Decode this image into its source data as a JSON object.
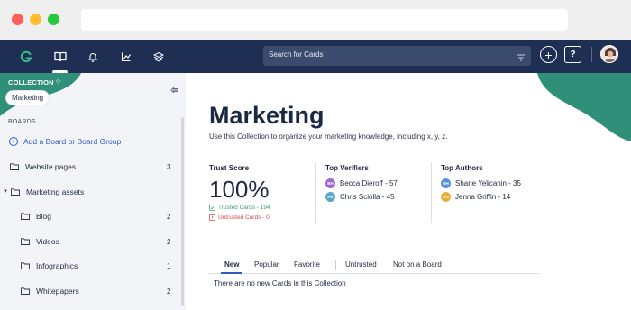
{
  "colors": {
    "nav_bg": "#1f2f54",
    "accent_green": "#2f8f78",
    "link_blue": "#2d5cc6",
    "trusted_green": "#3ea36a",
    "untrusted_red": "#d64a4a"
  },
  "nav": {
    "icons": [
      "logo-icon",
      "book-icon",
      "bell-icon",
      "chart-icon",
      "layers-icon"
    ],
    "search_placeholder": "Search for Cards",
    "help_label": "?"
  },
  "sidebar": {
    "collection_label": "COLLECTION",
    "collection_selected": "Marketing",
    "boards_label": "BOARDS",
    "add_board_label": "Add a Board or Board Group",
    "items": [
      {
        "label": "Website pages",
        "count": "3"
      },
      {
        "label": "Marketing assets",
        "count": ""
      },
      {
        "label": "Blog",
        "count": "2"
      },
      {
        "label": "Videos",
        "count": "2"
      },
      {
        "label": "Infographics",
        "count": "1"
      },
      {
        "label": "Whitepapers",
        "count": "2"
      }
    ]
  },
  "main": {
    "title": "Marketing",
    "subtitle": "Use this Collection to organize your marketing knowledge, including x, y, z.",
    "trust": {
      "label": "Trust Score",
      "value": "100%",
      "trusted": "Trusted Cards - 194",
      "untrusted": "Untrusted Cards - 0"
    },
    "verifiers": {
      "label": "Top Verifiers",
      "people": [
        {
          "initials": "BH",
          "text": "Becca Dieroff - 57",
          "color": "#a066d3"
        },
        {
          "initials": "PR",
          "text": "Chris Sciolla - 45",
          "color": "#5aa7c9"
        }
      ]
    },
    "authors": {
      "label": "Top Authors",
      "people": [
        {
          "initials": "BH",
          "text": "Shane Yelicanin - 35",
          "color": "#5b8fd6"
        },
        {
          "initials": "CG",
          "text": "Jenna Griffin - 14",
          "color": "#e5b13a"
        }
      ]
    },
    "tabs": [
      "New",
      "Popular",
      "Favorite",
      "Untrusted",
      "Not on a Board"
    ],
    "empty_message": "There are no new Cards in this Collection"
  }
}
